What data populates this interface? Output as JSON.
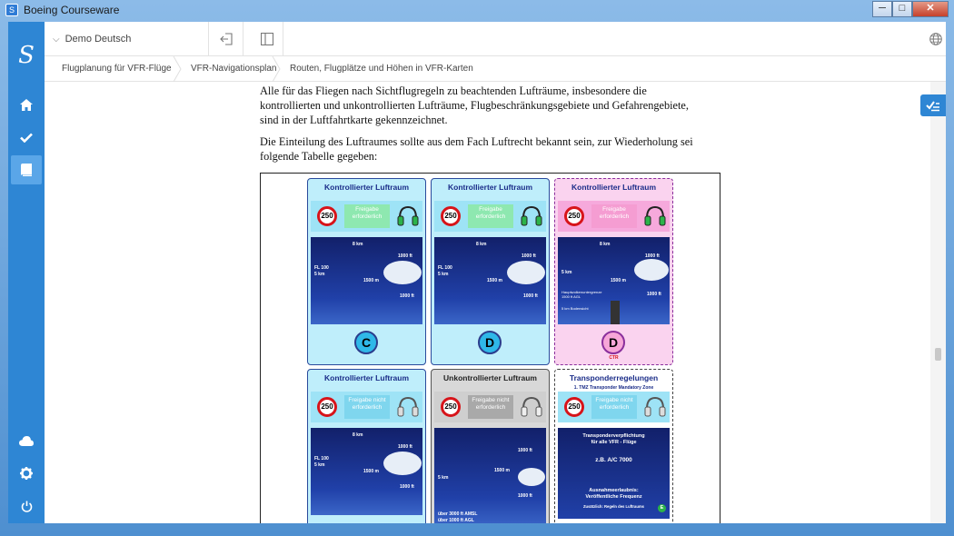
{
  "window": {
    "title": "Boeing Courseware",
    "app_icon_letter": "S",
    "buttons": {
      "minimize": "─",
      "maximize": "□",
      "close": "✕"
    }
  },
  "sidebar": {
    "logo": "S",
    "items": [
      {
        "name": "home-icon"
      },
      {
        "name": "checkmark-icon"
      },
      {
        "name": "book-icon",
        "active": true
      },
      {
        "name": "cloud-icon"
      },
      {
        "name": "gear-icon"
      },
      {
        "name": "power-icon"
      }
    ]
  },
  "topbar": {
    "course_label": "Demo Deutsch",
    "icons": [
      "exit-icon",
      "split-view-icon",
      "globe-icon"
    ]
  },
  "breadcrumb": [
    "Flugplanung für VFR-Flüge",
    "VFR-Navigationsplan",
    "Routen, Flugplätze und Höhen in VFR-Karten"
  ],
  "content": {
    "paragraph1": [
      "Alle für das Fliegen nach Sichtflugregeln zu beachtenden Lufträume, insbesondere die",
      "kontrollierten und unkontrollierten Lufträume, Flugbeschränkungsgebiete und Gefahrengebiete,",
      "sind in der Luftfahrtkarte gekennzeichnet."
    ],
    "paragraph2": [
      "Die Einteilung des Luftraumes sollte aus dem Fach Luftrecht bekannt sein, zur Wiederholung sei",
      "folgende Tabelle gegeben:"
    ]
  },
  "figure": {
    "cards": [
      {
        "heading": "Kontrollierter Luftraum",
        "speed": "250",
        "clearance": "Freigabe erforderlich",
        "badge": "C",
        "labels": [
          "8 km",
          "1000 ft",
          "FL 100",
          "5 km",
          "1500 m",
          "1000 ft"
        ]
      },
      {
        "heading": "Kontrollierter Luftraum",
        "speed": "250",
        "clearance": "Freigabe erforderlich",
        "badge": "D",
        "labels": [
          "8 km",
          "1000 ft",
          "FL 100",
          "5 km",
          "1500 m",
          "1000 ft"
        ]
      },
      {
        "heading": "Kontrollierter Luftraum",
        "speed": "250",
        "clearance": "Freigabe erforderlich",
        "badge": "D",
        "badge_sub": "CTR",
        "labels": [
          "8 km",
          "1000 ft",
          "5 km",
          "1500 m",
          "1000 ft",
          "Hauptwolkenuntergrenze 1500 ft AGL",
          "5 km Bodensicht"
        ]
      },
      {
        "heading": "Kontrollierter Luftraum",
        "speed": "250",
        "clearance": "Freigabe nicht erforderlich",
        "labels": [
          "8 km",
          "1000 ft",
          "FL 100",
          "5 km",
          "1500 m",
          "1000 ft"
        ]
      },
      {
        "heading": "Unkontrollierter Luftraum",
        "speed": "250",
        "clearance": "Freigabe nicht erforderlich",
        "labels": [
          "1000 ft",
          "1500 m",
          "5 km",
          "1000 ft",
          "über 3000 ft AMSL",
          "über 1000 ft AGL"
        ]
      },
      {
        "heading": "Transponderregelungen",
        "subheading": "1. TMZ Transponder Mandatory Zone",
        "speed": "250",
        "clearance": "Freigabe nicht erforderlich",
        "tmz_lines": [
          "Transponderverpflichtung",
          "für alle VFR - Flüge",
          "z.B. A/C 7000",
          "Ausnahmeerlaubnis:",
          "Veröffentliche Frequenz",
          "Zusätzlich: Regeln des Luftraums",
          "E"
        ]
      }
    ]
  },
  "colors": {
    "sidebar": "#2e86d4",
    "card_blue": "#bfeefb",
    "card_pink": "#fad3ef",
    "sign_red": "#d7141a",
    "heading_navy": "#1a2c88"
  }
}
